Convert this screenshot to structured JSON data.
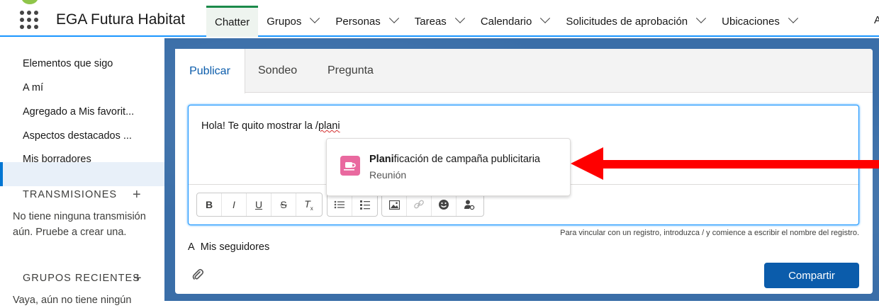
{
  "app": {
    "name": "EGA Futura Habitat"
  },
  "nav": {
    "items": [
      {
        "label": "Chatter",
        "active": true,
        "has_menu": false
      },
      {
        "label": "Grupos",
        "has_menu": true
      },
      {
        "label": "Personas",
        "has_menu": true
      },
      {
        "label": "Tareas",
        "has_menu": true
      },
      {
        "label": "Calendario",
        "has_menu": true
      },
      {
        "label": "Solicitudes de aprobación",
        "has_menu": true
      },
      {
        "label": "Ubicaciones",
        "has_menu": true
      }
    ],
    "overflow_label": "A"
  },
  "sidebar": {
    "links": [
      {
        "label": "Elementos que sigo"
      },
      {
        "label": "A mí"
      },
      {
        "label": "Agregado a Mis favorit..."
      },
      {
        "label": "Aspectos destacados ...",
        "active": true
      },
      {
        "label": "Mis borradores"
      }
    ],
    "transmisiones": {
      "heading": "TRANSMISIONES",
      "empty_text": "No tiene ninguna transmisión aún. Pruebe a crear una."
    },
    "grupos": {
      "heading": "GRUPOS RECIENTES",
      "empty_text": "Vaya, aún no tiene ningún"
    }
  },
  "publisher": {
    "tabs": [
      {
        "label": "Publicar",
        "active": true
      },
      {
        "label": "Sondeo"
      },
      {
        "label": "Pregunta"
      }
    ],
    "editor": {
      "text_before": "Hola! Te quito mostrar la ",
      "slash": "/",
      "typed": "plani"
    },
    "mention_suggestion": {
      "match": "Plani",
      "rest": "ficación de campaña publicitaria",
      "type": "Reunión",
      "icon": "meeting-cup-icon",
      "icon_color": "#e9699f"
    },
    "toolbar": {
      "bold": "B",
      "italic": "I",
      "underline": "U",
      "strike": "S",
      "clear": "T"
    },
    "hint": "Para vincular con un registro, introduzca / y comience a escribir el nombre del registro.",
    "audience": {
      "prefix": "A",
      "value": "Mis seguidores"
    },
    "share_label": "Compartir"
  },
  "colors": {
    "brand": "#0b5cab",
    "active_nav": "#1b8a4a",
    "annotation_arrow": "#ff0000"
  }
}
